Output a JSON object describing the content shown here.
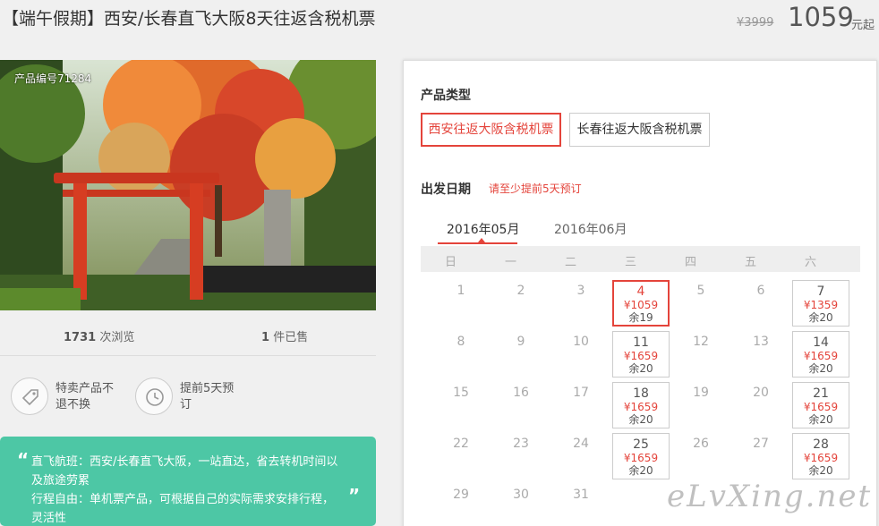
{
  "header": {
    "title": "【端午假期】西安/长春直飞大阪8天往返含税机票",
    "original_price": "¥3999",
    "price": "1059",
    "price_unit": "元起"
  },
  "gallery": {
    "product_code": "产品编号71284"
  },
  "stats": {
    "views": "1731",
    "views_label": "次浏览",
    "sold": "1",
    "sold_label": "件已售"
  },
  "features": [
    {
      "icon": "tag-icon",
      "text": "特卖产品不退不换"
    },
    {
      "icon": "clock-icon",
      "text": "提前5天预订"
    }
  ],
  "promo": {
    "line1": "直飞航班：西安/长春直飞大阪，一站直达，省去转机时间以及旅途劳累",
    "line2": "行程自由：单机票产品，可根据自己的实际需求安排行程，灵活性"
  },
  "booking": {
    "type_label": "产品类型",
    "types": [
      "西安往返大阪含税机票",
      "长春往返大阪含税机票"
    ],
    "date_label": "出发日期",
    "date_hint": "请至少提前5天预订",
    "months": [
      "2016年05月",
      "2016年06月"
    ],
    "weekdays": [
      "日",
      "一",
      "二",
      "三",
      "四",
      "五",
      "六"
    ],
    "calendar": [
      [
        {
          "d": "1"
        },
        {
          "d": "2"
        },
        {
          "d": "3"
        },
        {
          "d": "4",
          "p": "¥1059",
          "s": "余19",
          "sel": true
        },
        {
          "d": "5"
        },
        {
          "d": "6"
        },
        {
          "d": "7",
          "p": "¥1359",
          "s": "余20"
        }
      ],
      [
        {
          "d": "8"
        },
        {
          "d": "9"
        },
        {
          "d": "10"
        },
        {
          "d": "11",
          "p": "¥1659",
          "s": "余20"
        },
        {
          "d": "12"
        },
        {
          "d": "13"
        },
        {
          "d": "14",
          "p": "¥1659",
          "s": "余20"
        }
      ],
      [
        {
          "d": "15"
        },
        {
          "d": "16"
        },
        {
          "d": "17"
        },
        {
          "d": "18",
          "p": "¥1659",
          "s": "余20"
        },
        {
          "d": "19"
        },
        {
          "d": "20"
        },
        {
          "d": "21",
          "p": "¥1659",
          "s": "余20"
        }
      ],
      [
        {
          "d": "22"
        },
        {
          "d": "23"
        },
        {
          "d": "24"
        },
        {
          "d": "25",
          "p": "¥1659",
          "s": "余20"
        },
        {
          "d": "26"
        },
        {
          "d": "27"
        },
        {
          "d": "28",
          "p": "¥1659",
          "s": "余20"
        }
      ],
      [
        {
          "d": "29"
        },
        {
          "d": "30"
        },
        {
          "d": "31"
        }
      ]
    ]
  },
  "watermark": "eLvXing.net",
  "colors": {
    "accent": "#e4443b",
    "promo_bg": "#4dc7a5"
  }
}
